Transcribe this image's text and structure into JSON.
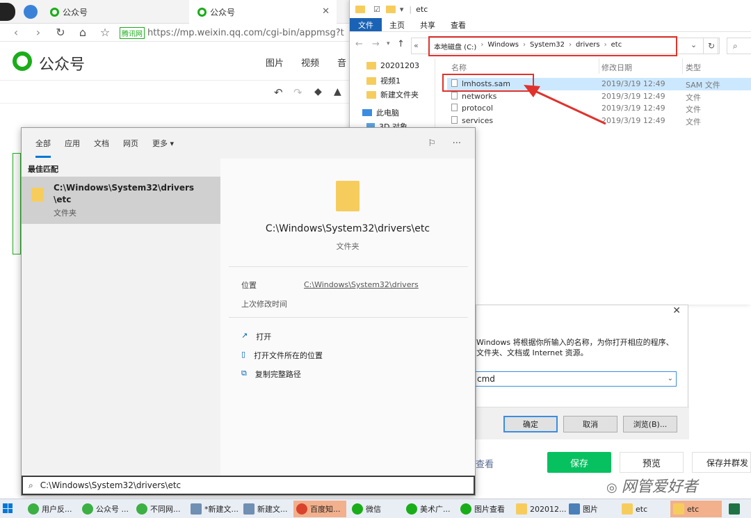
{
  "browser": {
    "tabs": [
      "公众号",
      "公众号"
    ],
    "url": "https://mp.weixin.qq.com/cgi-bin/appmsg?t",
    "site_badge": "腾讯网"
  },
  "weixin": {
    "logo_text": "公众号",
    "menu": [
      "图片",
      "视频",
      "音"
    ],
    "buttons": {
      "save": "保存",
      "preview": "预览",
      "save_send": "保存并群发"
    },
    "view_text": "查看"
  },
  "explorer": {
    "title": "etc",
    "ribbon_tabs": [
      "文件",
      "主页",
      "共享",
      "查看"
    ],
    "breadcrumb": [
      "本地磁盘 (C:)",
      "Windows",
      "System32",
      "drivers",
      "etc"
    ],
    "breadcrumb_prefix": "«",
    "headers": {
      "name": "名称",
      "date": "修改日期",
      "type": "类型"
    },
    "files": [
      {
        "name": "lmhosts.sam",
        "date": "2019/3/19 12:49",
        "type": "SAM 文件"
      },
      {
        "name": "networks",
        "date": "2019/3/19 12:49",
        "type": "文件"
      },
      {
        "name": "protocol",
        "date": "2019/3/19 12:49",
        "type": "文件"
      },
      {
        "name": "services",
        "date": "2019/3/19 12:49",
        "type": "文件"
      }
    ],
    "nav": [
      "20201203",
      "视频1",
      "新建文件夹",
      "此电脑",
      "3D 对象"
    ]
  },
  "search": {
    "tabs": [
      "全部",
      "应用",
      "文档",
      "网页",
      "更多"
    ],
    "section_label": "最佳匹配",
    "result_title_line1": "C:\\Windows\\System32\\drivers",
    "result_title_line2": "\\etc",
    "result_sub": "文件夹",
    "preview_title": "C:\\Windows\\System32\\drivers\\etc",
    "preview_sub": "文件夹",
    "location_label": "位置",
    "location_value": "C:\\Windows\\System32\\drivers",
    "modified_label": "上次修改时间",
    "actions": [
      "打开",
      "打开文件所在的位置",
      "复制完整路径"
    ],
    "query": "C:\\Windows\\System32\\drivers\\etc"
  },
  "run_dialog": {
    "description_line1": "Windows 将根据你所输入的名称，为你打开相应的程序、",
    "description_line2": "文件夹、文档或 Internet 资源。",
    "input_value": "cmd",
    "ok": "确定",
    "cancel": "取消",
    "browse": "浏览(B)..."
  },
  "watermark": "网管爱好者",
  "taskbar": [
    "用户反...",
    "公众号 ...",
    "不同网...",
    "*新建文...",
    "新建文...",
    "百度知...",
    "微信",
    "美术广...",
    "图片查看",
    "202012...",
    "图片",
    "etc",
    "etc"
  ],
  "colors": {
    "wechat_green": "#07c160",
    "highlight_red": "#e0322d",
    "selection": "#cce8ff"
  }
}
